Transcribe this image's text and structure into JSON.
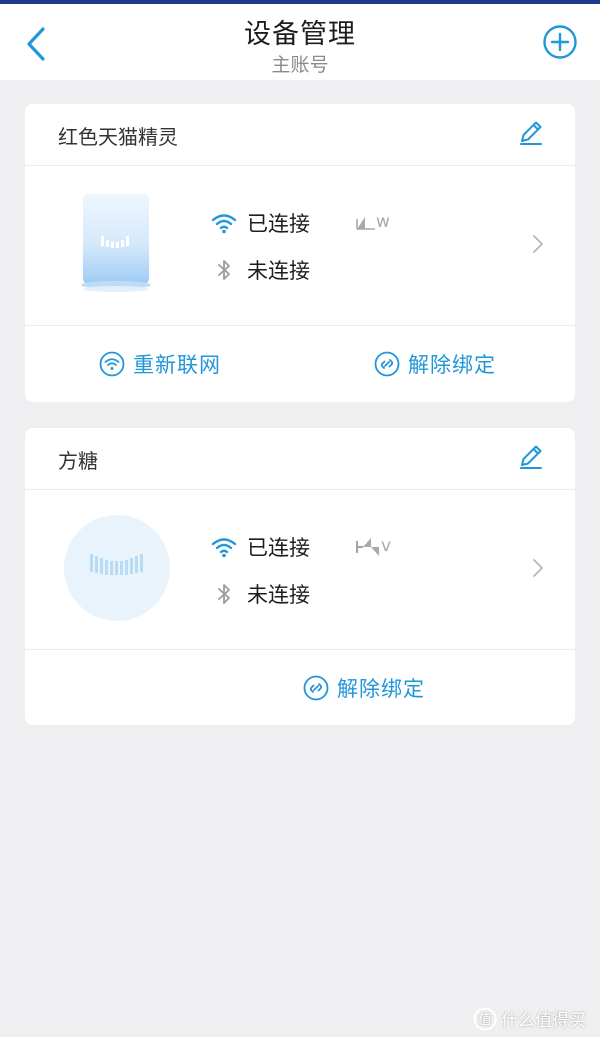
{
  "header": {
    "title": "设备管理",
    "subtitle": "主账号",
    "back_icon": "chevron-left-icon",
    "add_icon": "plus-circle-icon"
  },
  "colors": {
    "accent": "#2196d9",
    "background": "#efeff1",
    "card": "#ffffff",
    "top_bar": "#1e3a8a",
    "text_primary": "#1d1d1f",
    "text_secondary": "#8a8a8e"
  },
  "devices": [
    {
      "name": "红色天猫精灵",
      "wifi_status": "已连接",
      "bluetooth_status": "未连接",
      "signal_text": "w",
      "actions": [
        "重新联网",
        "解除绑定"
      ]
    },
    {
      "name": "方糖",
      "wifi_status": "已连接",
      "bluetooth_status": "未连接",
      "signal_text": "v",
      "actions": [
        "解除绑定"
      ]
    }
  ],
  "watermark": "什么值得买"
}
